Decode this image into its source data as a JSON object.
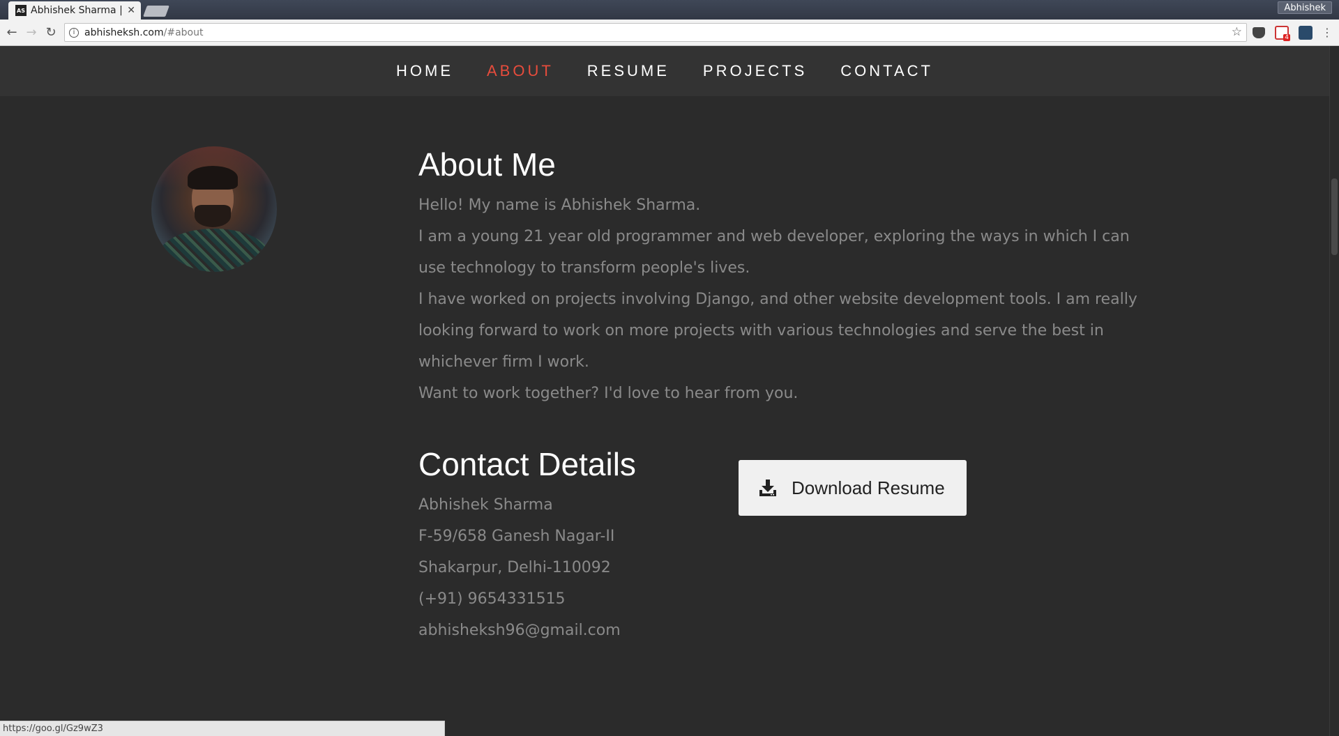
{
  "browser": {
    "tab_title": "Abhishek Sharma | ...",
    "tab_favicon_text": "AS",
    "profile_name": "Abhishek",
    "url_host": "abhisheksh.com",
    "url_path": "/#about",
    "gmail_badge_count": "4",
    "status_url": "https://goo.gl/Gz9wZ3"
  },
  "nav": {
    "items": [
      {
        "label": "HOME",
        "active": false
      },
      {
        "label": "ABOUT",
        "active": true
      },
      {
        "label": "RESUME",
        "active": false
      },
      {
        "label": "PROJECTS",
        "active": false
      },
      {
        "label": "CONTACT",
        "active": false
      }
    ],
    "active_color": "#e74c3c"
  },
  "about": {
    "heading": "About Me",
    "lines": [
      "Hello! My name is Abhishek Sharma.",
      "I am a young 21 year old programmer and web developer, exploring the ways in which I can use technology to transform people's lives.",
      "I have worked on projects involving Django, and other website development tools. I am really looking forward to work on more projects with various technologies and serve the best in whichever firm I work.",
      "Want to work together? I'd love to hear from you."
    ]
  },
  "contact": {
    "heading": "Contact Details",
    "name": "Abhishek Sharma",
    "address_line1": "F-59/658 Ganesh Nagar-II",
    "address_line2": "Shakarpur, Delhi-110092",
    "phone": "(+91) 9654331515",
    "email": "abhisheksh96@gmail.com"
  },
  "download": {
    "label": "Download Resume",
    "icon": "download-icon"
  }
}
